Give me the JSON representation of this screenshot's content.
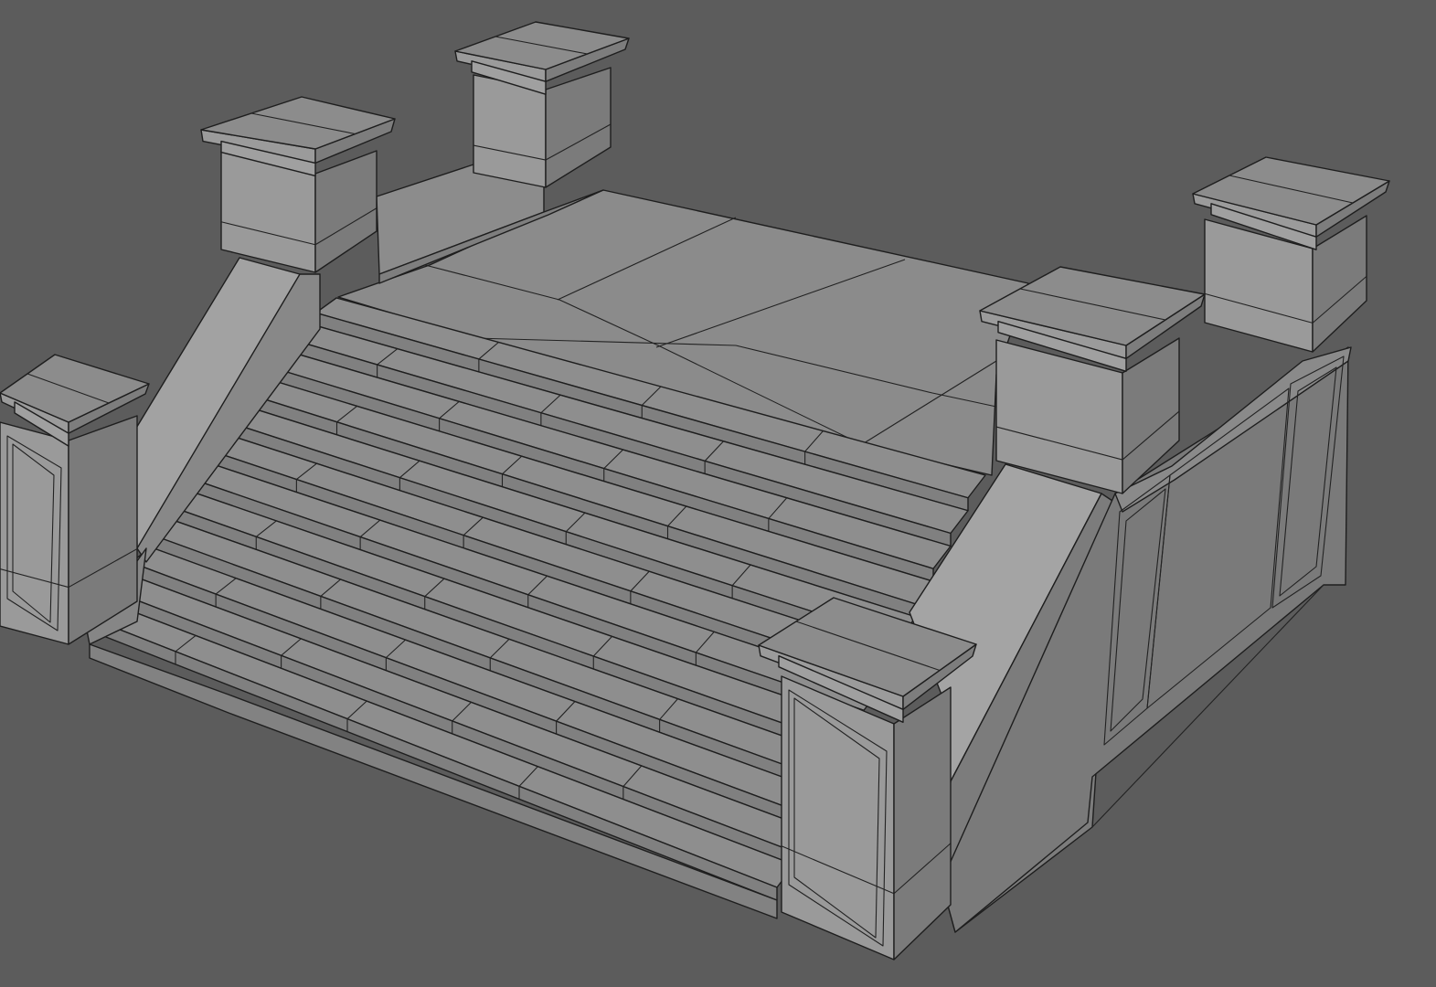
{
  "scene": {
    "object": "staircase-with-pillars",
    "render_mode": "solid-wireframe",
    "colors": {
      "background": "#5c5c5c",
      "top_face": "#8c8c8c",
      "left_face": "#9a9a9a",
      "right_face": "#7b7b7b",
      "light_face": "#a3a3a3",
      "stair_tread": "#8e8e8e",
      "stair_riser": "#808080",
      "wire": "#222222"
    },
    "stairs": {
      "step_count": 12,
      "column_divisions": 4
    },
    "pillars": {
      "count": 6
    },
    "platform": {
      "tile_rows": 3,
      "tile_cols": 3
    }
  }
}
